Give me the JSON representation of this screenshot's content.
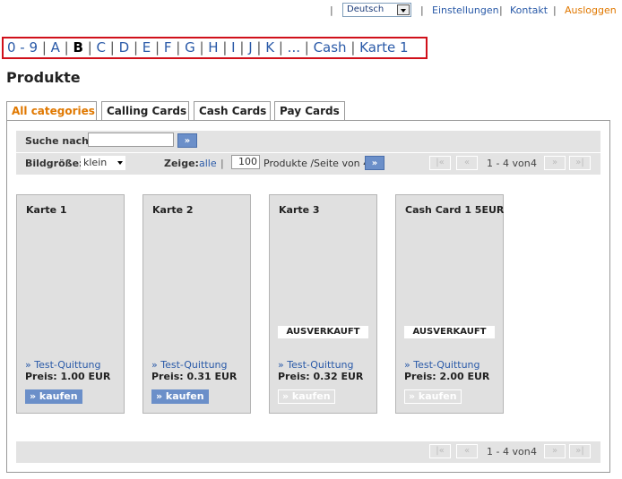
{
  "topnav": {
    "language": "Deutsch",
    "settings": "Einstellungen",
    "contact": "Kontakt",
    "logout": "Ausloggen",
    "sep": "|"
  },
  "alphabet": {
    "items": [
      "0 - 9",
      "A",
      "B",
      "C",
      "D",
      "E",
      "F",
      "G",
      "H",
      "I",
      "J",
      "K",
      "...",
      "Cash",
      "Karte 1"
    ],
    "active": "B"
  },
  "page_title": "Produkte",
  "tabs": [
    {
      "label": "All categories",
      "active": true
    },
    {
      "label": "Calling Cards",
      "active": false
    },
    {
      "label": "Cash Cards",
      "active": false
    },
    {
      "label": "Pay Cards",
      "active": false
    }
  ],
  "search": {
    "label": "Suche nach:",
    "value": "",
    "go": "»"
  },
  "options": {
    "size_label": "Bildgröße:",
    "size_value": "klein",
    "show_label": "Zeige:",
    "show_all": "alle",
    "sep": "|",
    "per_page": "100",
    "per_page_text": "Produkte /Seite von 4",
    "go": "»"
  },
  "pager": {
    "first": "|«",
    "prev": "«",
    "range": "1 - 4 von",
    "total": "4",
    "next": "»",
    "last": "»|"
  },
  "products": [
    {
      "name": "Karte 1",
      "sold_out": "",
      "receipt": "» Test-Quittung",
      "price": "Preis: 1.00 EUR",
      "buy": "» kaufen",
      "available": true
    },
    {
      "name": "Karte 2",
      "sold_out": "",
      "receipt": "» Test-Quittung",
      "price": "Preis: 0.31 EUR",
      "buy": "» kaufen",
      "available": true
    },
    {
      "name": "Karte 3",
      "sold_out": "AUSVERKAUFT",
      "receipt": "» Test-Quittung",
      "price": "Preis: 0.32 EUR",
      "buy": "» kaufen",
      "available": false
    },
    {
      "name": "Cash Card 1 5EUR",
      "sold_out": "AUSVERKAUFT",
      "receipt": "» Test-Quittung",
      "price": "Preis: 2.00 EUR",
      "buy": "» kaufen",
      "available": false
    }
  ]
}
